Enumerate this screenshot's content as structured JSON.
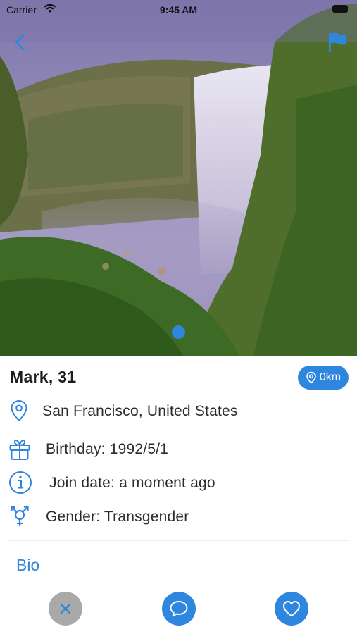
{
  "status_bar": {
    "carrier": "Carrier",
    "time": "9:45 AM"
  },
  "profile": {
    "name_age": "Mark, 31",
    "distance": "0km",
    "location": "San Francisco, United States",
    "birthday": "Birthday: 1992/5/1",
    "join_date": "Join date: a moment ago",
    "gender": "Gender: Transgender"
  },
  "sections": {
    "bio_label": "Bio"
  },
  "colors": {
    "accent": "#2f86de",
    "dismiss": "#a9a9a9"
  },
  "icons": {
    "back": "chevron-left-icon",
    "report": "flag-icon",
    "location": "map-pin-icon",
    "birthday": "gift-icon",
    "join_date": "info-icon",
    "gender": "transgender-icon",
    "dismiss": "close-icon",
    "chat": "chat-bubble-icon",
    "like": "heart-icon"
  }
}
